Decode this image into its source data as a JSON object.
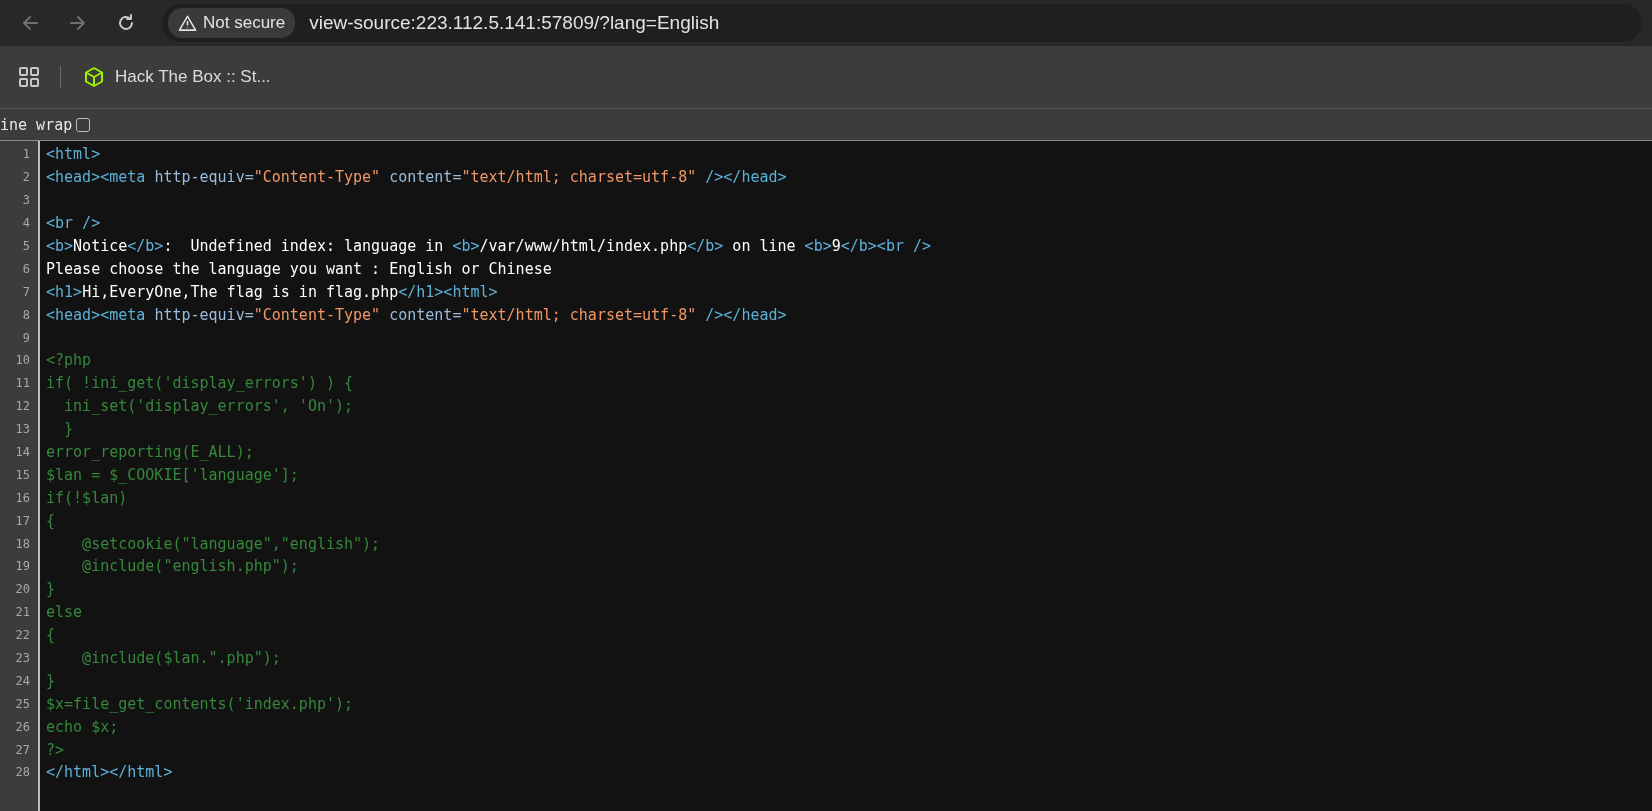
{
  "toolbar": {
    "nav_buttons": [
      {
        "kind": "back",
        "disabled": true
      },
      {
        "kind": "forward",
        "disabled": true
      },
      {
        "kind": "reload",
        "disabled": false
      }
    ],
    "security_chip": "Not secure",
    "url": "view-source:223.112.5.141:57809/?lang=English"
  },
  "bookmarks_bar": {
    "items": [
      {
        "label": "Hack The Box :: St..."
      }
    ]
  },
  "line_wrap": {
    "label": "ine wrap",
    "checked": false
  },
  "source_lines": [
    {
      "number": "1",
      "segments": [
        {
          "kind": "tag",
          "text": "<html>"
        }
      ]
    },
    {
      "number": "2",
      "segments": [
        {
          "kind": "tag",
          "text": "<head><meta "
        },
        {
          "kind": "attr",
          "text": "http-equiv="
        },
        {
          "kind": "value",
          "text": "\"Content-Type\""
        },
        {
          "kind": "attr",
          "text": " content="
        },
        {
          "kind": "value",
          "text": "\"text/html; charset=utf-8\""
        },
        {
          "kind": "tag",
          "text": " /></head>"
        }
      ]
    },
    {
      "number": "3"
    },
    {
      "number": "4",
      "segments": [
        {
          "kind": "tag",
          "text": "<br />"
        }
      ]
    },
    {
      "number": "5",
      "segments": [
        {
          "kind": "tag",
          "text": "<b>"
        },
        {
          "kind": "text",
          "text": "Notice"
        },
        {
          "kind": "tag",
          "text": "</b>"
        },
        {
          "kind": "text",
          "text": ":  Undefined index: language in "
        },
        {
          "kind": "tag",
          "text": "<b>"
        },
        {
          "kind": "text",
          "text": "/var/www/html/index.php"
        },
        {
          "kind": "tag",
          "text": "</b>"
        },
        {
          "kind": "text",
          "text": " on line "
        },
        {
          "kind": "tag",
          "text": "<b>"
        },
        {
          "kind": "text",
          "text": "9"
        },
        {
          "kind": "tag",
          "text": "</b><br />"
        }
      ]
    },
    {
      "number": "6",
      "segments": [
        {
          "kind": "text",
          "text": "Please choose the language you want : English or Chinese"
        }
      ]
    },
    {
      "number": "7",
      "segments": [
        {
          "kind": "tag",
          "text": "<h1>"
        },
        {
          "kind": "text",
          "text": "Hi,EveryOne,The flag is in flag.php"
        },
        {
          "kind": "tag",
          "text": "</h1><html>"
        }
      ]
    },
    {
      "number": "8",
      "segments": [
        {
          "kind": "tag",
          "text": "<head><meta "
        },
        {
          "kind": "attr",
          "text": "http-equiv="
        },
        {
          "kind": "value",
          "text": "\"Content-Type\""
        },
        {
          "kind": "attr",
          "text": " content="
        },
        {
          "kind": "value",
          "text": "\"text/html; charset=utf-8\""
        },
        {
          "kind": "tag",
          "text": " /></head>"
        }
      ]
    },
    {
      "number": "9"
    },
    {
      "number": "10",
      "segments": [
        {
          "kind": "comment",
          "text": "<?php"
        }
      ]
    },
    {
      "number": "11",
      "segments": [
        {
          "kind": "comment",
          "text": "if( !ini_get('display_errors') ) {"
        }
      ]
    },
    {
      "number": "12",
      "segments": [
        {
          "kind": "comment",
          "text": "  ini_set('display_errors', 'On');"
        }
      ]
    },
    {
      "number": "13",
      "segments": [
        {
          "kind": "comment",
          "text": "  }"
        }
      ]
    },
    {
      "number": "14",
      "segments": [
        {
          "kind": "comment",
          "text": "error_reporting(E_ALL);"
        }
      ]
    },
    {
      "number": "15",
      "segments": [
        {
          "kind": "comment",
          "text": "$lan = $_COOKIE['language'];"
        }
      ]
    },
    {
      "number": "16",
      "segments": [
        {
          "kind": "comment",
          "text": "if(!$lan)"
        }
      ]
    },
    {
      "number": "17",
      "segments": [
        {
          "kind": "comment",
          "text": "{"
        }
      ]
    },
    {
      "number": "18",
      "segments": [
        {
          "kind": "comment",
          "text": "    @setcookie(\"language\",\"english\");"
        }
      ]
    },
    {
      "number": "19",
      "segments": [
        {
          "kind": "comment",
          "text": "    @include(\"english.php\");"
        }
      ]
    },
    {
      "number": "20",
      "segments": [
        {
          "kind": "comment",
          "text": "}"
        }
      ]
    },
    {
      "number": "21",
      "segments": [
        {
          "kind": "comment",
          "text": "else"
        }
      ]
    },
    {
      "number": "22",
      "segments": [
        {
          "kind": "comment",
          "text": "{"
        }
      ]
    },
    {
      "number": "23",
      "segments": [
        {
          "kind": "comment",
          "text": "    @include($lan.\".php\");"
        }
      ]
    },
    {
      "number": "24",
      "segments": [
        {
          "kind": "comment",
          "text": "}"
        }
      ]
    },
    {
      "number": "25",
      "segments": [
        {
          "kind": "comment",
          "text": "$x=file_get_contents('index.php');"
        }
      ]
    },
    {
      "number": "26",
      "segments": [
        {
          "kind": "comment",
          "text": "echo $x;"
        }
      ]
    },
    {
      "number": "27",
      "segments": [
        {
          "kind": "comment",
          "text": "?>"
        }
      ]
    },
    {
      "number": "28",
      "segments": [
        {
          "kind": "tag",
          "text": "</html></html>"
        }
      ]
    }
  ]
}
